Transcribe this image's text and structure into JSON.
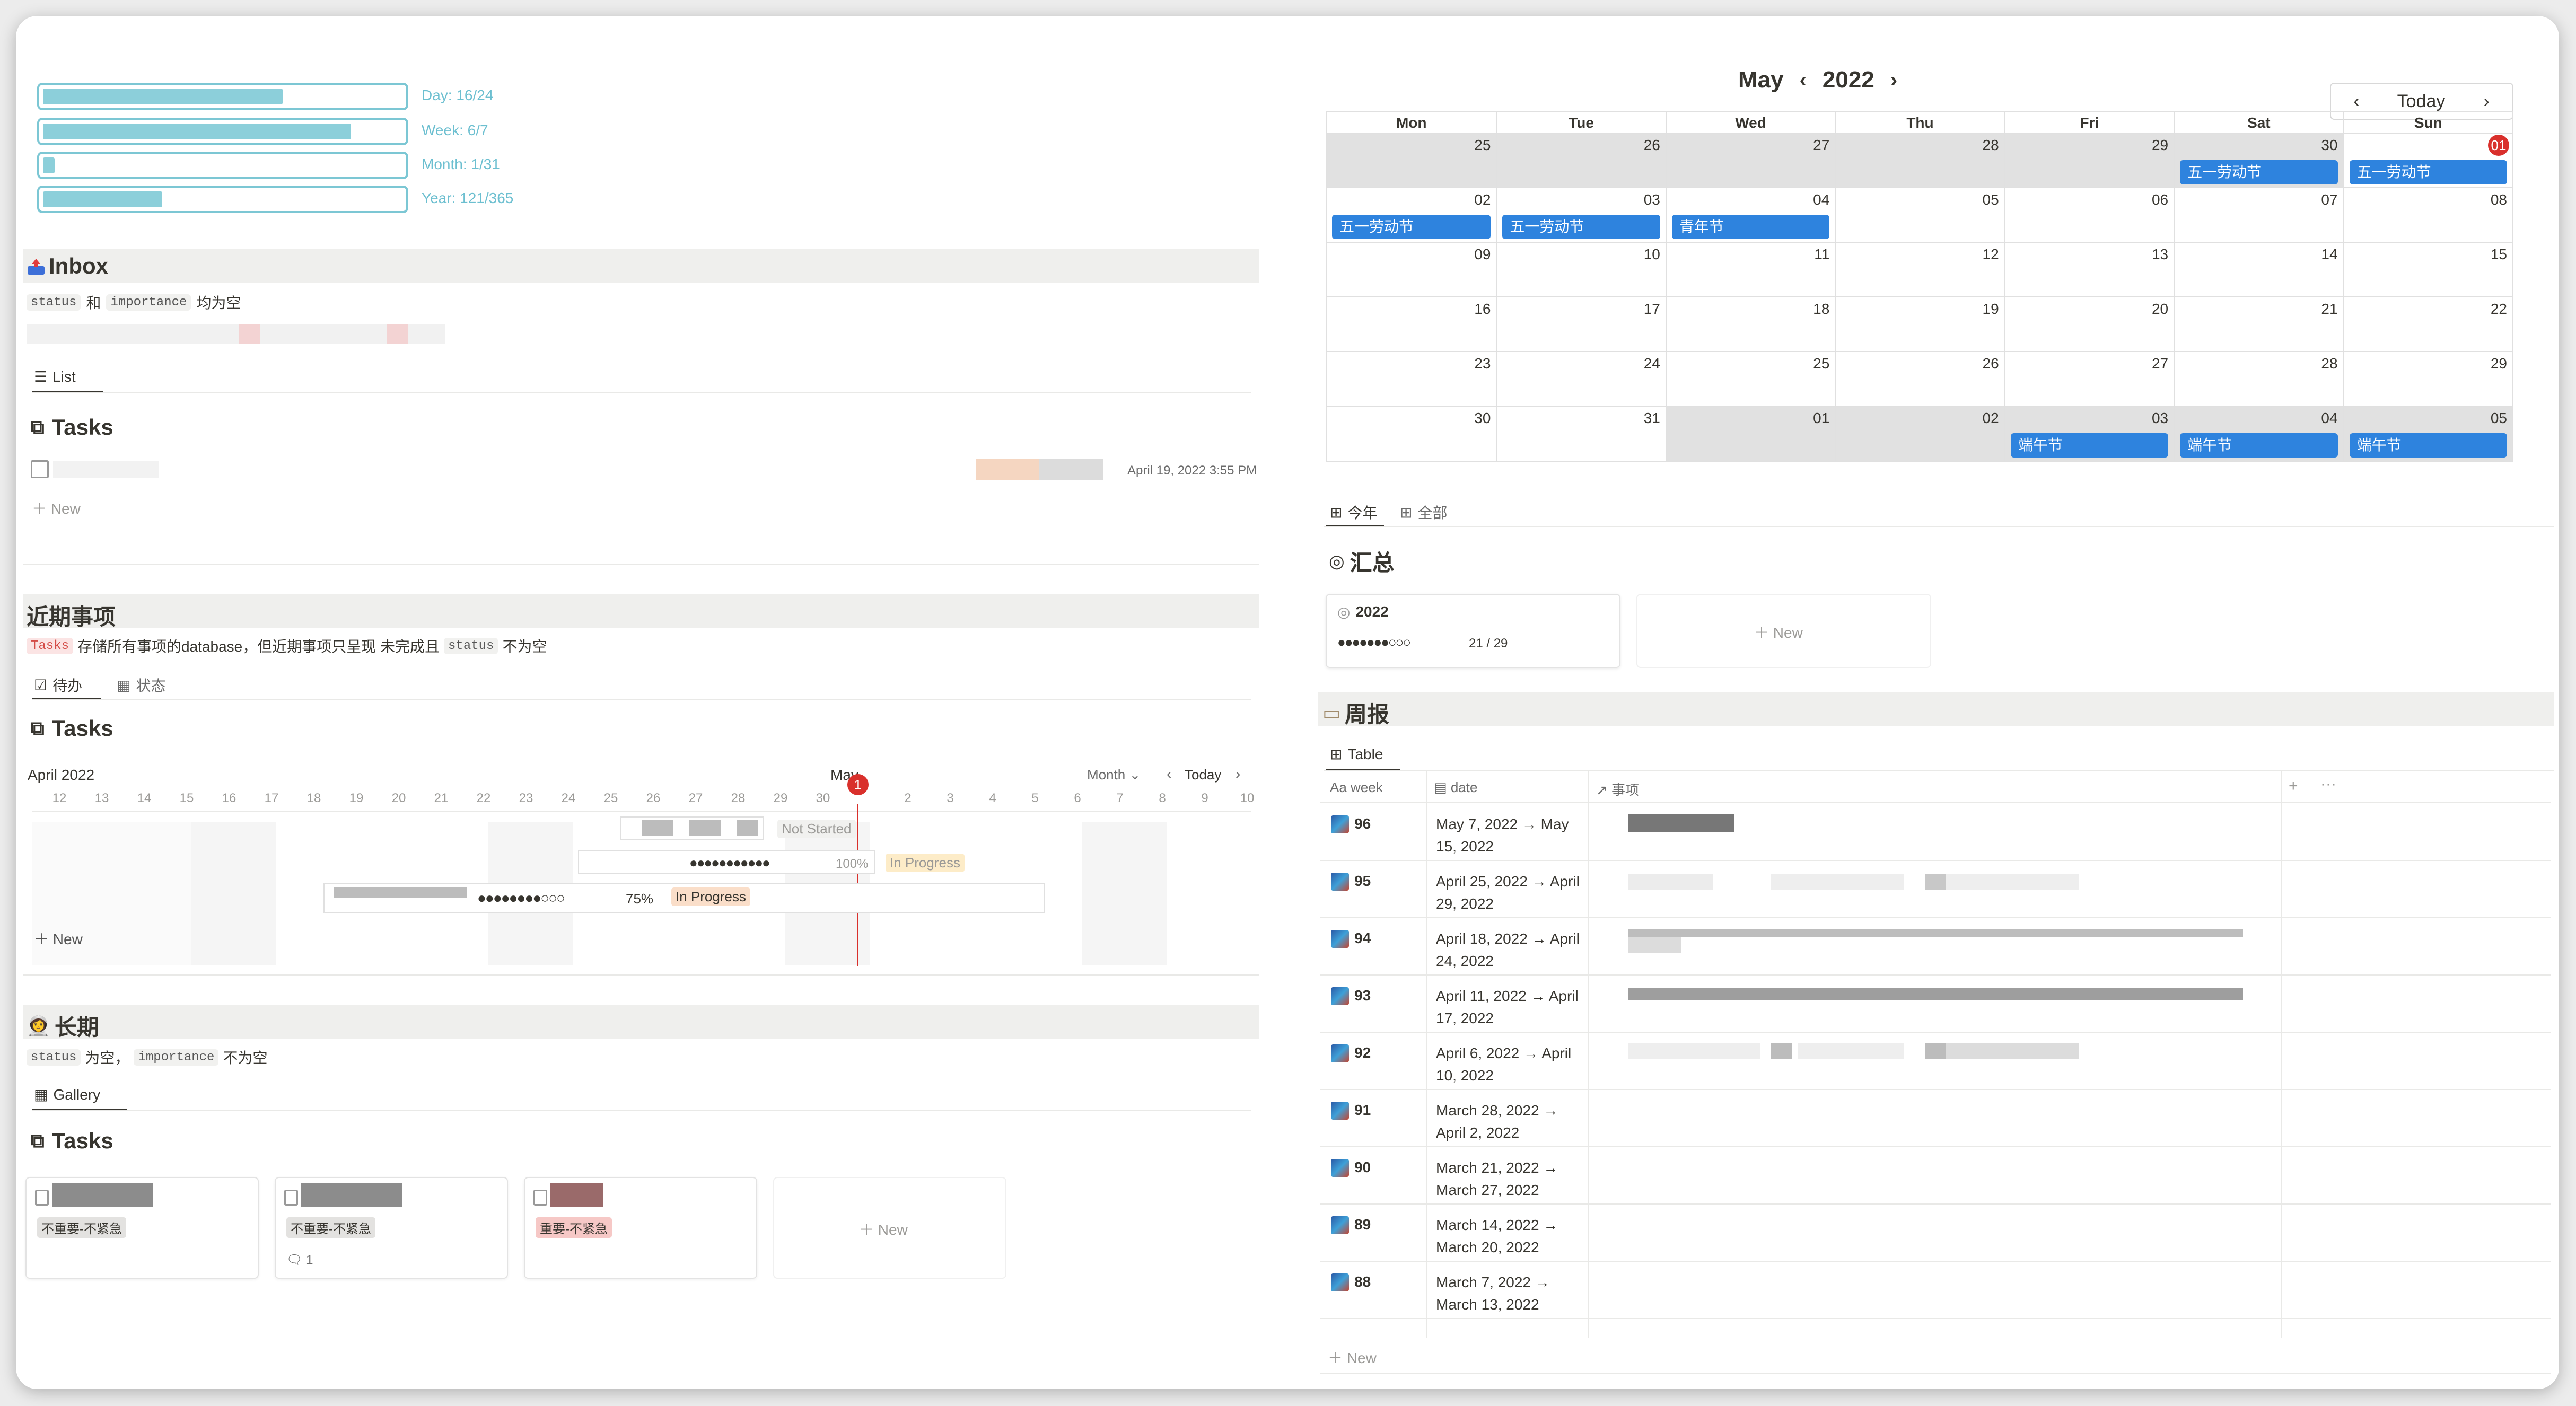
{
  "progress": [
    {
      "label": "Day: 16/24",
      "fraction": 0.6667
    },
    {
      "label": "Week: 6/7",
      "fraction": 0.857
    },
    {
      "label": "Month: 1/31",
      "fraction": 0.032
    },
    {
      "label": "Year: 121/365",
      "fraction": 0.3315
    }
  ],
  "inbox": {
    "title": "Inbox",
    "filter_code1": "status",
    "filter_and": "和",
    "filter_code2": "importance",
    "filter_tail": "均为空",
    "tab": "List",
    "db_title": "Tasks",
    "row_date": "April 19, 2022 3:55 PM",
    "new": "New"
  },
  "upcoming": {
    "title": "近期事项",
    "desc_code": "Tasks",
    "desc_mid": "存储所有事项的database，但近期事项只呈现 未完成且",
    "desc_code2": "status",
    "desc_tail": "不为空",
    "tabs": [
      "待办",
      "状态"
    ],
    "db_title": "Tasks",
    "gantt_month_left": "April 2022",
    "gantt_month_mid": "May",
    "gantt_view": "Month",
    "gantt_today": "Today",
    "days": [
      "12",
      "13",
      "14",
      "15",
      "16",
      "17",
      "18",
      "19",
      "20",
      "21",
      "22",
      "23",
      "24",
      "25",
      "26",
      "27",
      "28",
      "29",
      "30",
      "1",
      "2",
      "3",
      "4",
      "5",
      "6",
      "7",
      "8",
      "9",
      "10"
    ],
    "bars": [
      {
        "status": "Not Started",
        "progress": ""
      },
      {
        "status": "In Progress",
        "progress": "100%",
        "dots": "●●●●●●●●●●●"
      },
      {
        "status": "In Progress",
        "progress": "75%",
        "dots": "●●●●●●●●○○○"
      }
    ],
    "new": "New"
  },
  "longterm": {
    "title": "长期",
    "filter_code1": "status",
    "filter_mid": "为空，",
    "filter_code2": "importance",
    "filter_tail": "不为空",
    "tab": "Gallery",
    "db_title": "Tasks",
    "cards": [
      {
        "tag": "不重要-不紧急",
        "comments": ""
      },
      {
        "tag": "不重要-不紧急",
        "comments": "1"
      },
      {
        "tag": "重要-不紧急",
        "comments": ""
      }
    ],
    "new": "New"
  },
  "calendar": {
    "month": "May",
    "year": "2022",
    "today_btn": "Today",
    "weekdays": [
      "Mon",
      "Tue",
      "Wed",
      "Thu",
      "Fri",
      "Sat",
      "Sun"
    ],
    "weeks": [
      [
        {
          "d": "25",
          "grey": true
        },
        {
          "d": "26",
          "grey": true
        },
        {
          "d": "27",
          "grey": true
        },
        {
          "d": "28",
          "grey": true
        },
        {
          "d": "29",
          "grey": true
        },
        {
          "d": "30",
          "grey": true,
          "ev": "五一劳动节"
        },
        {
          "d": "01",
          "today": true,
          "ev": "五一劳动节"
        }
      ],
      [
        {
          "d": "02",
          "ev": "五一劳动节"
        },
        {
          "d": "03",
          "ev": "五一劳动节"
        },
        {
          "d": "04",
          "ev": "青年节"
        },
        {
          "d": "05"
        },
        {
          "d": "06"
        },
        {
          "d": "07"
        },
        {
          "d": "08"
        }
      ],
      [
        {
          "d": "09"
        },
        {
          "d": "10"
        },
        {
          "d": "11"
        },
        {
          "d": "12"
        },
        {
          "d": "13"
        },
        {
          "d": "14"
        },
        {
          "d": "15"
        }
      ],
      [
        {
          "d": "16"
        },
        {
          "d": "17"
        },
        {
          "d": "18"
        },
        {
          "d": "19"
        },
        {
          "d": "20"
        },
        {
          "d": "21"
        },
        {
          "d": "22"
        }
      ],
      [
        {
          "d": "23"
        },
        {
          "d": "24"
        },
        {
          "d": "25"
        },
        {
          "d": "26"
        },
        {
          "d": "27"
        },
        {
          "d": "28"
        },
        {
          "d": "29"
        }
      ],
      [
        {
          "d": "30"
        },
        {
          "d": "31"
        },
        {
          "d": "01",
          "grey": true
        },
        {
          "d": "02",
          "grey": true
        },
        {
          "d": "03",
          "grey": true,
          "ev": "端午节"
        },
        {
          "d": "04",
          "grey": true,
          "ev": "端午节"
        },
        {
          "d": "05",
          "grey": true,
          "ev": "端午节"
        }
      ]
    ]
  },
  "summary": {
    "tabs": [
      "今年",
      "全部"
    ],
    "title": "汇总",
    "card_year": "2022",
    "card_dots": "●●●●●●●○○○",
    "card_count": "21 / 29",
    "new": "New"
  },
  "weekly": {
    "title": "周报",
    "tab": "Table",
    "columns": [
      "week",
      "date",
      "事项"
    ],
    "rows": [
      {
        "week": "96",
        "date": "May 7, 2022 → May 15, 2022"
      },
      {
        "week": "95",
        "date": "April 25, 2022 → April 29, 2022"
      },
      {
        "week": "94",
        "date": "April 18, 2022 → April 24, 2022"
      },
      {
        "week": "93",
        "date": "April 11, 2022 → April 17, 2022"
      },
      {
        "week": "92",
        "date": "April 6, 2022 → April 10, 2022"
      },
      {
        "week": "91",
        "date": "March 28, 2022 → April 2, 2022"
      },
      {
        "week": "90",
        "date": "March 21, 2022 → March 27, 2022"
      },
      {
        "week": "89",
        "date": "March 14, 2022 → March 20, 2022"
      },
      {
        "week": "88",
        "date": "March 7, 2022 → March 13, 2022"
      }
    ],
    "new": "New"
  }
}
